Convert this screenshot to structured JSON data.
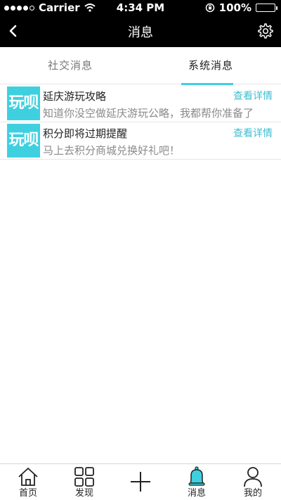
{
  "status_bar": {
    "carrier": "Carrier",
    "time": "4:34 PM",
    "battery": "100%"
  },
  "nav": {
    "title": "消息"
  },
  "tabs": [
    {
      "label": "社交消息",
      "active": false
    },
    {
      "label": "系统消息",
      "active": true
    }
  ],
  "messages": [
    {
      "icon_text": "玩呗",
      "title": "延庆游玩攻略",
      "body": "知道你没空做延庆游玩公略，我都帮你准备了",
      "link": "查看详情"
    },
    {
      "icon_text": "玩呗",
      "title": "积分即将过期提醒",
      "body": "马上去积分商城兑换好礼吧！",
      "link": "查看详情"
    }
  ],
  "tabbar": [
    {
      "label": "首页",
      "icon": "home-icon"
    },
    {
      "label": "发现",
      "icon": "grid-icon"
    },
    {
      "label": "",
      "icon": "plus-icon"
    },
    {
      "label": "消息",
      "icon": "bell-icon",
      "active": true
    },
    {
      "label": "我的",
      "icon": "user-icon"
    }
  ],
  "colors": {
    "accent": "#3fd0e0",
    "header_bg": "#000000"
  }
}
